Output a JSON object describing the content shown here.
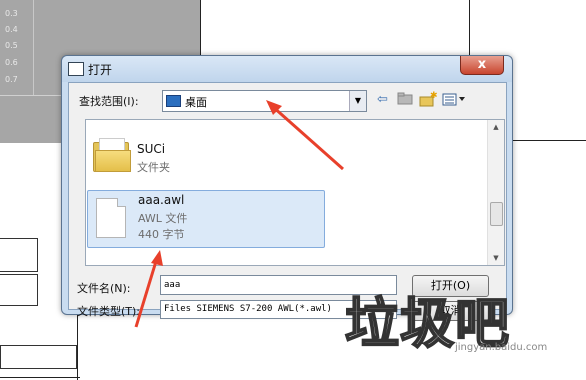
{
  "background": {
    "rows": [
      "0.3",
      "0.4",
      "0.5",
      "0.6",
      "0.7"
    ]
  },
  "dialog": {
    "title": "打开",
    "close_label": "x",
    "look_in": {
      "label": "查找范围(I):",
      "value": "桌面"
    },
    "toolbar_icons": [
      "back-arrow-icon",
      "up-folder-icon",
      "new-folder-icon",
      "view-menu-icon"
    ],
    "files": [
      {
        "name": "SUCi",
        "type": "文件夹",
        "icon": "folder-icon"
      },
      {
        "name": "aaa.awl",
        "type": "AWL 文件",
        "size": "440 字节",
        "icon": "document-icon",
        "selected": true
      }
    ],
    "filename": {
      "label": "文件名(N):",
      "value": "aaa"
    },
    "filetype": {
      "label": "文件类型(T):",
      "value": "Files SIEMENS S7-200 AWL(*.awl)"
    },
    "open_button": "打开(O)",
    "cancel_button": "取消"
  },
  "watermark": {
    "text": "垃圾吧",
    "url": "jingyan.baidu.com"
  },
  "colors": {
    "annotation_arrow": "#e8402b",
    "selection": "#dbe9f8"
  }
}
